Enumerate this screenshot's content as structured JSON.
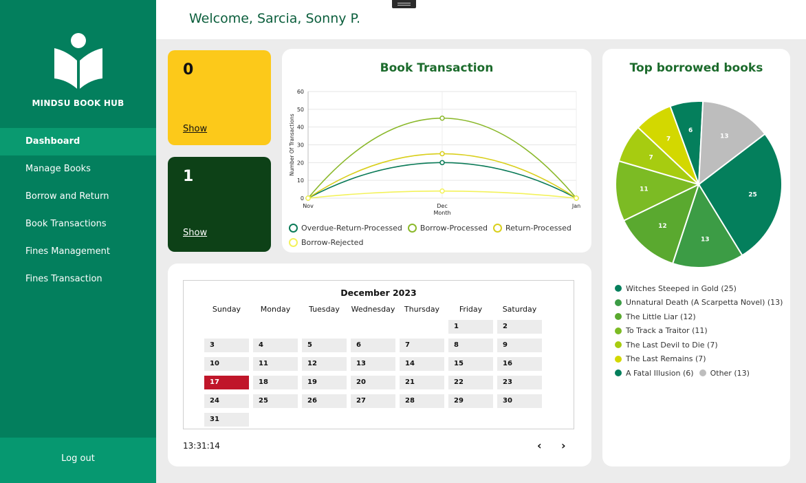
{
  "app": {
    "brand": "MINDSU BOOK HUB",
    "icon": "open-book-reader-icon"
  },
  "sidebar": {
    "items": [
      {
        "label": "Dashboard",
        "active": true
      },
      {
        "label": "Manage Books",
        "active": false
      },
      {
        "label": "Borrow and Return",
        "active": false
      },
      {
        "label": "Book Transactions",
        "active": false
      },
      {
        "label": "Fines Management",
        "active": false
      },
      {
        "label": "Fines Transaction",
        "active": false
      }
    ],
    "logout": "Log out"
  },
  "header": {
    "welcome": "Welcome,",
    "user_name": "Sarcia, Sonny P."
  },
  "stats": [
    {
      "value": "0",
      "link": "Show",
      "color": "#fcc91a"
    },
    {
      "value": "1",
      "link": "Show",
      "color": "#0d4117"
    }
  ],
  "transactions_chart": {
    "title": "Book Transaction"
  },
  "top_books_chart": {
    "title": "Top borrowed books"
  },
  "chart_data": [
    {
      "type": "line",
      "title": "Book Transaction",
      "xlabel": "Month",
      "ylabel": "Number Of Transactions",
      "x": [
        "Nov",
        "Dec",
        "Jan"
      ],
      "ylim": [
        0,
        60
      ],
      "yticks": [
        0,
        10,
        20,
        30,
        40,
        50,
        60
      ],
      "grid": true,
      "legend": "bottom",
      "series": [
        {
          "name": "Overdue-Return-Processed",
          "values": [
            0,
            20,
            0
          ],
          "color": "#0a7a57"
        },
        {
          "name": "Borrow-Processed",
          "values": [
            0,
            45,
            0
          ],
          "color": "#8ab82a"
        },
        {
          "name": "Return-Processed",
          "values": [
            0,
            25,
            0
          ],
          "color": "#d9cf1c"
        },
        {
          "name": "Borrow-Rejected",
          "values": [
            0,
            4,
            0
          ],
          "color": "#f3f25a"
        }
      ]
    },
    {
      "type": "pie",
      "title": "Top borrowed books",
      "legend": "bottom",
      "slices": [
        {
          "label": "Witches Steeped in Gold",
          "value": 25,
          "color": "#047f5c"
        },
        {
          "label": "Unnatural Death (A Scarpetta Novel)",
          "value": 13,
          "color": "#3c9c45"
        },
        {
          "label": "The Little Liar",
          "value": 12,
          "color": "#5aa92f"
        },
        {
          "label": "To Track a Traitor",
          "value": 11,
          "color": "#7cbb24"
        },
        {
          "label": "The Last Devil to Die",
          "value": 7,
          "color": "#a7cc10"
        },
        {
          "label": "The Last Remains",
          "value": 7,
          "color": "#d3d800"
        },
        {
          "label": "A Fatal Illusion",
          "value": 6,
          "color": "#047f5c"
        },
        {
          "label": "Other",
          "value": 13,
          "color": "#bdbdbd"
        }
      ],
      "legend_entries": [
        "Witches Steeped in Gold (25)",
        "Unnatural Death (A Scarpetta Novel) (13)",
        "The Little Liar (12)",
        "To Track a Traitor (11)",
        "The Last Devil to Die (7)",
        "The Last Remains (7)",
        "A Fatal Illusion (6)",
        "Other (13)"
      ]
    }
  ],
  "calendar": {
    "month": "December 2023",
    "weekdays": [
      "Sunday",
      "Monday",
      "Tuesday",
      "Wednesday",
      "Thursday",
      "Friday",
      "Saturday"
    ],
    "first_weekday_index": 5,
    "days_in_month": 31,
    "today": 17,
    "today_color": "#c0162a",
    "clock": "13:31:14",
    "prev": "‹",
    "next": "›"
  }
}
